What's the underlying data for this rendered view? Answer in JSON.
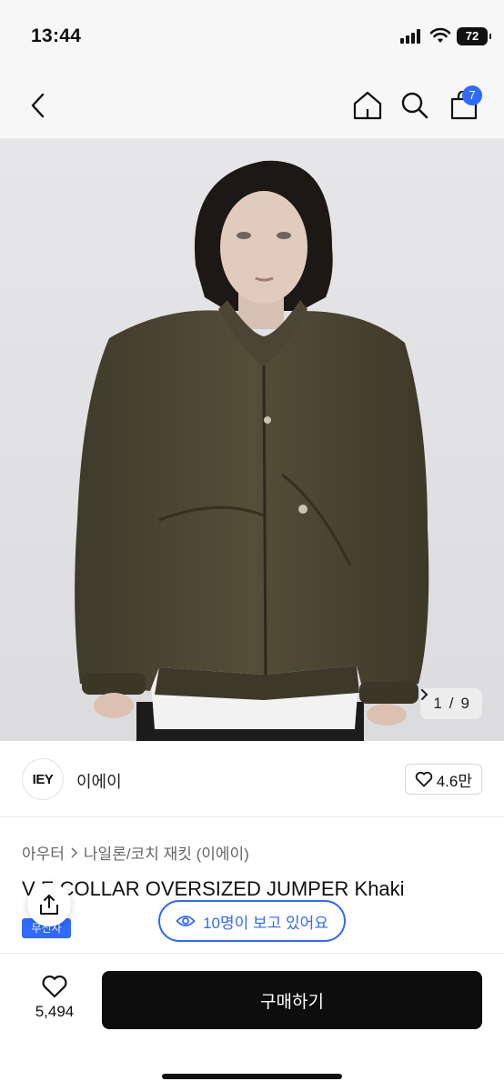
{
  "status_bar": {
    "time": "13:44",
    "battery": "72"
  },
  "nav": {
    "cart_count": "7"
  },
  "gallery": {
    "current": "1",
    "separator": "/",
    "total": "9"
  },
  "brand": {
    "logo_text": "IEY",
    "name": "이에이",
    "likes": "4.6만"
  },
  "breadcrumb": {
    "category": "아우터",
    "subcategory": "나일론/코치 재킷 (이에이)"
  },
  "product": {
    "title_visible": "V  E COLLAR OVERSIZED JUMPER Khaki",
    "tag_label": "무신사"
  },
  "viewers": {
    "text": "10명이 보고 있어요"
  },
  "bottom": {
    "wish_count": "5,494",
    "buy_label": "구매하기"
  },
  "colors": {
    "accent": "#2f6bff",
    "buy_button": "#0d0d0d",
    "jacket": "#4a4532"
  },
  "icons": [
    "back-icon",
    "home-icon",
    "search-icon",
    "shopping-bag-icon",
    "heart-icon",
    "share-icon",
    "eye-icon",
    "chevron-right-icon"
  ]
}
